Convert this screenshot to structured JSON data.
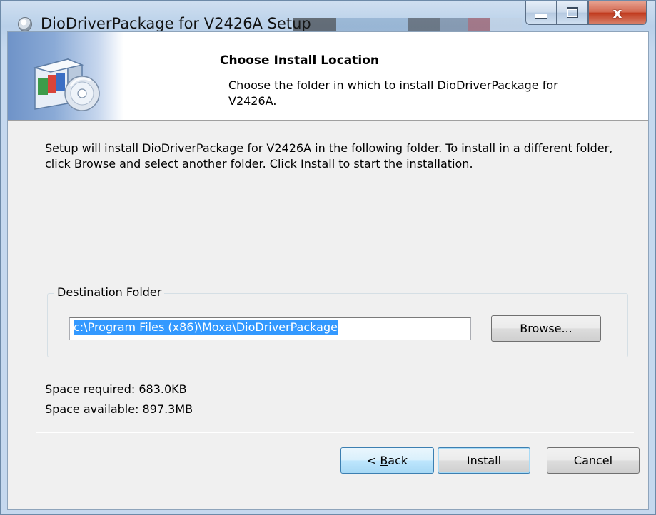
{
  "window": {
    "title": "DioDriverPackage for V2426A Setup",
    "close_glyph": "x",
    "accent": "#c0391c"
  },
  "header": {
    "title": "Choose Install Location",
    "subtitle": "Choose the folder in which to install DioDriverPackage for V2426A."
  },
  "main": {
    "description": "Setup will install DioDriverPackage for V2426A in the following folder. To install in a different folder, click Browse and select another folder. Click Install to start the installation.",
    "destination": {
      "legend": "Destination Folder",
      "path": "c:\\Program Files (x86)\\Moxa\\DioDriverPackage",
      "browse_label": "Browse..."
    },
    "space_required": "Space required: 683.0KB",
    "space_available": "Space available: 897.3MB"
  },
  "footer": {
    "back_prefix": "< ",
    "back_accel": "B",
    "back_rest": "ack",
    "install_label": "Install",
    "cancel_label": "Cancel"
  }
}
